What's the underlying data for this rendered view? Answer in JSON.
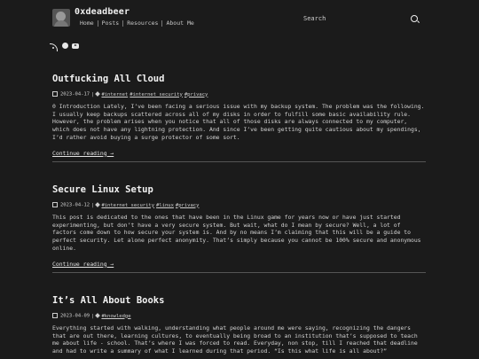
{
  "site": {
    "title": "0xdeadbeer"
  },
  "nav": {
    "items": [
      "Home",
      "Posts",
      "Resources",
      "About Me"
    ]
  },
  "search": {
    "placeholder": "Search"
  },
  "social": [
    "rss-icon",
    "github-icon",
    "youtube-icon"
  ],
  "posts": [
    {
      "title": "Outfucking All Cloud",
      "date": "2023-04-17",
      "tags": [
        "#internet",
        "#internet security",
        "#privacy"
      ],
      "summary": "0 Introduction Lately, I’ve been facing a serious issue with my backup system. The problem was the following. I usually keep backups scattered across all of my disks in order to fulfill some basic availability rule. However, the problem arises when you notice that all of those disks are always connected to my computer, which does not have any lightning protection. And since I’ve been getting quite cautious about my spendings, I’d rather avoid buying a surge protector of some sort.",
      "more": "Continue reading →"
    },
    {
      "title": "Secure Linux Setup",
      "date": "2023-04-12",
      "tags": [
        "#internet security",
        "#linux",
        "#privacy"
      ],
      "summary": "This post is dedicated to the ones that have been in the Linux game for years now or have just started experimenting, but don’t have a very secure system. But wait, what do I mean by secure? Well, a lot of factors come down to how secure your system is. And by no means I’m claiming that this will be a guide to perfect security. Let alone perfect anonymity. That’s simply because you cannot be 100% secure and anonymous online.",
      "more": "Continue reading →"
    },
    {
      "title": "It’s All About Books",
      "date": "2023-04-09",
      "tags": [
        "#knowledge"
      ],
      "summary": "Everything started with walking, understanding what people around me were saying, recognizing the dangers that are out there, learning cultures, to eventually being broad to an institution that’s supposed to teach me about life - school. That’s where I was forced to read. Everyday, non stop, till I reached that deadline and had to write a summary of what I learned during that period. “Is this what life is all about?”",
      "more": ""
    }
  ]
}
